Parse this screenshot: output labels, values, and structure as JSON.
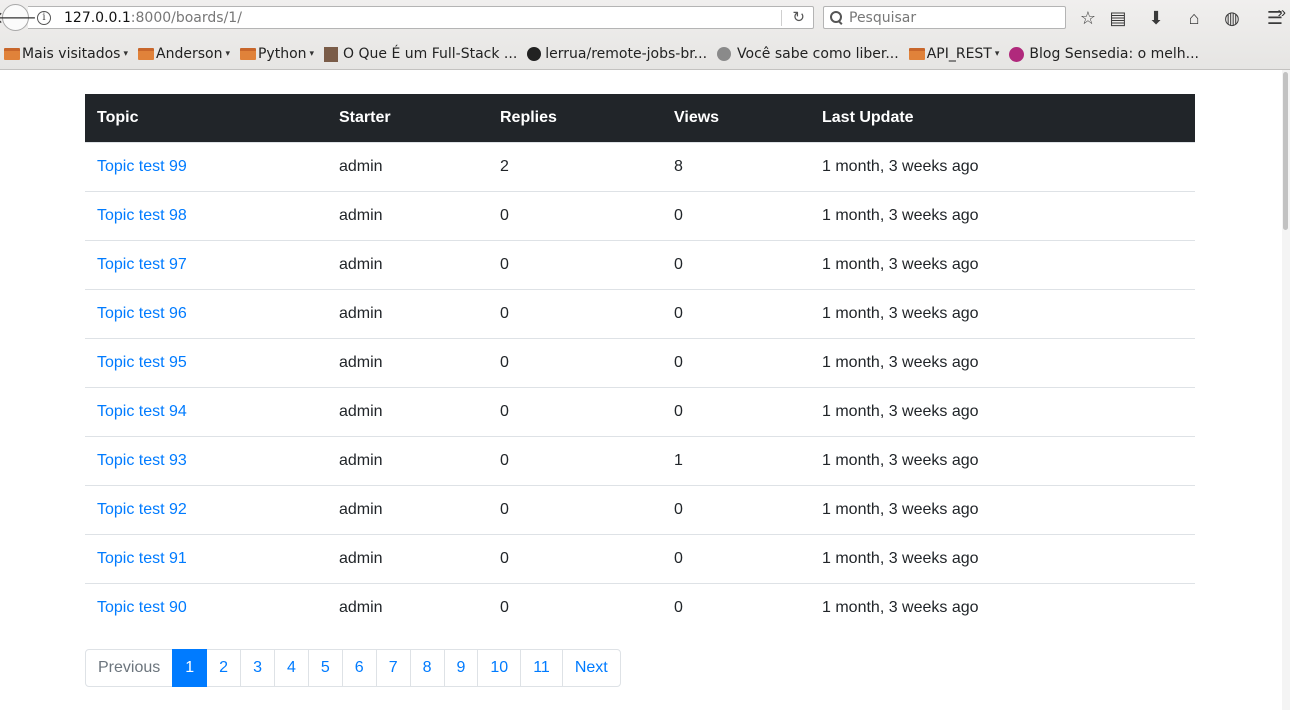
{
  "browser": {
    "url_host": "127.0.0.1",
    "url_rest": ":8000/boards/1/",
    "search_placeholder": "Pesquisar",
    "back_glyph": "🡐",
    "info_glyph": "i",
    "reload_glyph": "↻",
    "toolbar_icons": [
      {
        "name": "bookmark-star-icon",
        "glyph": "☆"
      },
      {
        "name": "reading-list-icon",
        "glyph": "▤"
      },
      {
        "name": "downloads-icon",
        "glyph": "⬇"
      },
      {
        "name": "home-icon",
        "glyph": "⌂"
      },
      {
        "name": "pocket-icon",
        "glyph": "◍"
      },
      {
        "name": "menu-icon",
        "glyph": "☰"
      }
    ],
    "bookmarks": [
      {
        "label": "Mais visitados",
        "icon": "folder",
        "dropdown": true
      },
      {
        "label": "Anderson",
        "icon": "folder",
        "dropdown": true
      },
      {
        "label": "Python",
        "icon": "folder",
        "dropdown": true
      },
      {
        "label": "O Que É um Full-Stack ...",
        "icon": "avatar",
        "dropdown": false
      },
      {
        "label": "lerrua/remote-jobs-br...",
        "icon": "github",
        "dropdown": false
      },
      {
        "label": "Você sabe como liber...",
        "icon": "globe",
        "dropdown": false
      },
      {
        "label": "API_REST",
        "icon": "folder",
        "dropdown": true
      },
      {
        "label": "Blog Sensedia: o melh...",
        "icon": "sensedia",
        "dropdown": false
      }
    ],
    "overflow_glyph": "»"
  },
  "table": {
    "headers": [
      "Topic",
      "Starter",
      "Replies",
      "Views",
      "Last Update"
    ],
    "rows": [
      {
        "topic": "Topic test 99",
        "starter": "admin",
        "replies": "2",
        "views": "8",
        "last_update": "1 month, 3 weeks ago"
      },
      {
        "topic": "Topic test 98",
        "starter": "admin",
        "replies": "0",
        "views": "0",
        "last_update": "1 month, 3 weeks ago"
      },
      {
        "topic": "Topic test 97",
        "starter": "admin",
        "replies": "0",
        "views": "0",
        "last_update": "1 month, 3 weeks ago"
      },
      {
        "topic": "Topic test 96",
        "starter": "admin",
        "replies": "0",
        "views": "0",
        "last_update": "1 month, 3 weeks ago"
      },
      {
        "topic": "Topic test 95",
        "starter": "admin",
        "replies": "0",
        "views": "0",
        "last_update": "1 month, 3 weeks ago"
      },
      {
        "topic": "Topic test 94",
        "starter": "admin",
        "replies": "0",
        "views": "0",
        "last_update": "1 month, 3 weeks ago"
      },
      {
        "topic": "Topic test 93",
        "starter": "admin",
        "replies": "0",
        "views": "1",
        "last_update": "1 month, 3 weeks ago"
      },
      {
        "topic": "Topic test 92",
        "starter": "admin",
        "replies": "0",
        "views": "0",
        "last_update": "1 month, 3 weeks ago"
      },
      {
        "topic": "Topic test 91",
        "starter": "admin",
        "replies": "0",
        "views": "0",
        "last_update": "1 month, 3 weeks ago"
      },
      {
        "topic": "Topic test 90",
        "starter": "admin",
        "replies": "0",
        "views": "0",
        "last_update": "1 month, 3 weeks ago"
      }
    ]
  },
  "pagination": {
    "previous_label": "Previous",
    "pages": [
      "1",
      "2",
      "3",
      "4",
      "5",
      "6",
      "7",
      "8",
      "9",
      "10",
      "11"
    ],
    "active_page": "1",
    "next_label": "Next"
  },
  "colors": {
    "header_bg": "#212529",
    "link": "#007bff",
    "active_page_bg": "#007bff",
    "disabled_text": "#6c757d"
  }
}
